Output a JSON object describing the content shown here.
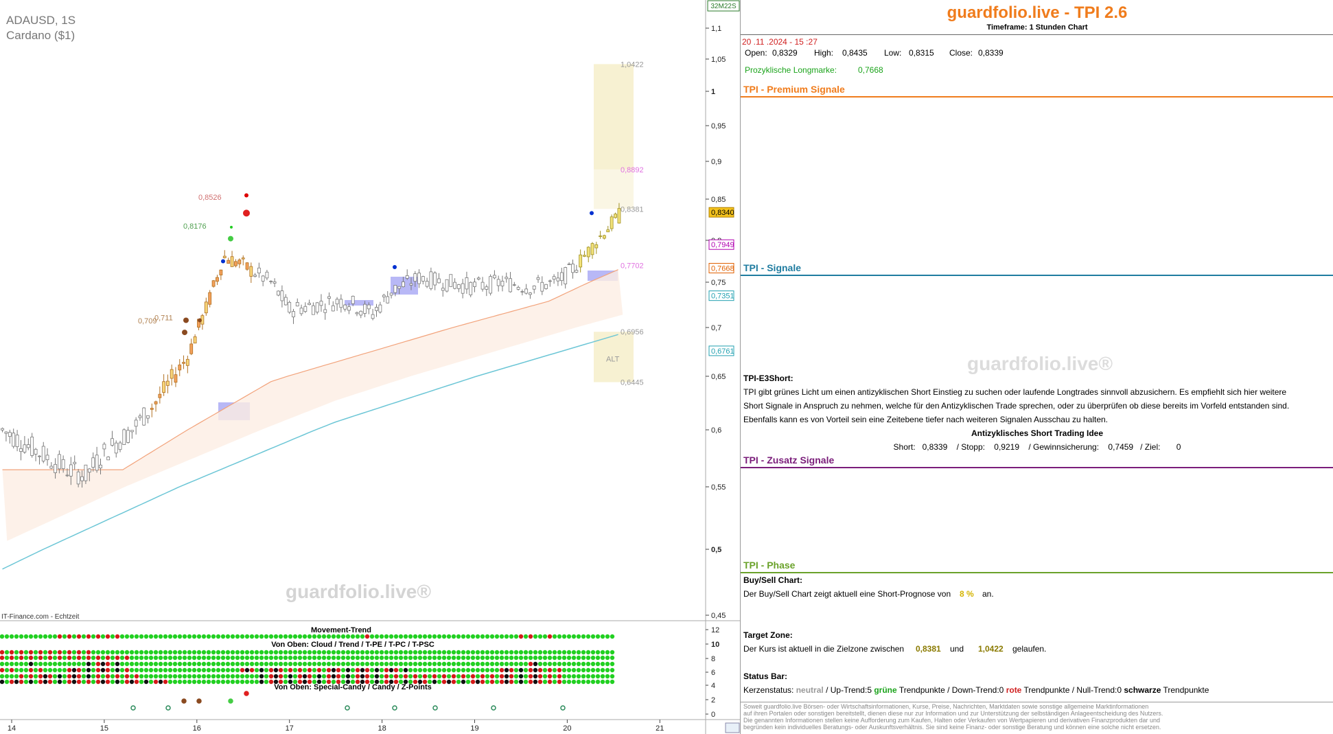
{
  "chart_header": {
    "symbol": "ADAUSD, 1S",
    "name": "Cardano ($1)",
    "timer_badge": "32M22S",
    "source": "IT-Finance.com - Echtzeit",
    "watermark": "guardfolio.live®"
  },
  "chart_data": {
    "type": "candlestick",
    "x_ticks": [
      "14",
      "15",
      "16",
      "17",
      "18",
      "19",
      "20",
      "21"
    ],
    "y_ticks": [
      "1,1",
      "1,05",
      "1",
      "0,95",
      "0,9",
      "0,85",
      "0,8",
      "0,75",
      "0,7",
      "0,65",
      "0,6",
      "0,55",
      "0,5",
      "0,45"
    ],
    "ylim": [
      0.45,
      1.13
    ],
    "price_tags": [
      {
        "label": "0,8340",
        "value": 0.834,
        "bg": "#f4c21d",
        "fg": "#000"
      },
      {
        "label": "0,7949",
        "value": 0.7949,
        "bg": "#fff",
        "fg": "#b000b0"
      },
      {
        "label": "0,7668",
        "value": 0.7668,
        "bg": "#fff",
        "fg": "#e06000"
      },
      {
        "label": "0,7351",
        "value": 0.7351,
        "bg": "#fff",
        "fg": "#20a0b0"
      },
      {
        "label": "0,6761",
        "value": 0.6761,
        "bg": "#fff",
        "fg": "#20a0b0"
      }
    ],
    "level_labels": [
      {
        "label": "1,0422",
        "value": 1.0422,
        "color": "#999"
      },
      {
        "label": "0,8892",
        "value": 0.8892,
        "color": "#e070e0"
      },
      {
        "label": "0,8381",
        "value": 0.8381,
        "color": "#999"
      },
      {
        "label": "0,7702",
        "value": 0.7702,
        "color": "#e070e0"
      },
      {
        "label": "0,6956",
        "value": 0.6956,
        "color": "#999"
      },
      {
        "label": "0,6445",
        "value": 0.6445,
        "color": "#999"
      }
    ],
    "annotations": [
      {
        "label": "0,8526",
        "value": 0.8526,
        "color": "#d07070"
      },
      {
        "label": "0,8176",
        "value": 0.8176,
        "color": "#50a050"
      },
      {
        "label": "0,711",
        "value": 0.711,
        "color": "#b08050"
      },
      {
        "label": "0,709",
        "value": 0.709,
        "color": "#b08050"
      },
      {
        "label": "ALT",
        "value": 0.668,
        "color": "#999"
      }
    ],
    "series": [
      {
        "name": "",
        "x": [
          13.9,
          14.3,
          14.6,
          14.8,
          15.0,
          15.3,
          15.6,
          15.9,
          16.1,
          16.3,
          16.5,
          16.8,
          17.0,
          17.3,
          17.6,
          17.9,
          18.1,
          18.4,
          18.7,
          19.0,
          19.3,
          19.6,
          19.9,
          20.1,
          20.4,
          20.6
        ],
        "values": [
          0.6,
          0.58,
          0.565,
          0.56,
          0.58,
          0.6,
          0.63,
          0.67,
          0.72,
          0.78,
          0.77,
          0.75,
          0.72,
          0.725,
          0.73,
          0.715,
          0.74,
          0.755,
          0.75,
          0.745,
          0.75,
          0.745,
          0.75,
          0.77,
          0.81,
          0.834
        ]
      }
    ]
  },
  "indicators": {
    "title_1": "Movement-Trend",
    "title_2": "Von Oben: Cloud / Trend / T-PE / T-PC / T-PSC",
    "title_3": "Von Oben: Special-Candy / Candy / Z-Points",
    "y_ticks": [
      "12",
      "10",
      "8",
      "6",
      "4",
      "2",
      "0"
    ]
  },
  "panel": {
    "title": "guardfolio.live - TPI 2.6",
    "timeframe": "Timeframe: 1 Stunden Chart",
    "datetime": "20 .11 .2024  - 15 :27",
    "open_label": "Open:",
    "open": "0,8329",
    "high_label": "High:",
    "high": "0,8435",
    "low_label": "Low:",
    "low": "0,8315",
    "close_label": "Close:",
    "close": "0,8339",
    "longmark_label": "Prozyklische Longmarke:",
    "longmark": "0,7668",
    "premium_title": "TPI - Premium Signale",
    "signale_title": "TPI - Signale",
    "e3_title": "TPI-E3Short:",
    "e3_text": "TPI gibt grünes Licht um einen antizyklischen Short Einstieg zu suchen oder laufende Longtrades sinnvoll abzusichern. Es empfiehlt sich hier weitere Short Signale in Anspruch zu nehmen, welche für den Antizyklischen Trade sprechen, oder zu überprüfen ob diese bereits im Vorfeld entstanden sind. Ebenfalls kann es von Vorteil sein eine Zeitebene tiefer nach weiteren Signalen Ausschau zu halten.",
    "idea_title": "Antizyklisches Short Trading Idee",
    "idea_line": "Short:   0,8339    / Stopp:    0,9219    / Gewinnsicherung:    0,7459   / Ziel:       0",
    "zusatz_title": "TPI - Zusatz Signale",
    "phase_title": "TPI - Phase",
    "buysell_title": "Buy/Sell Chart:",
    "buysell_pre": "Der Buy/Sell Chart zeigt aktuell eine Short-Prognose von",
    "buysell_val": "8 %",
    "buysell_post": "an.",
    "target_title": "Target Zone:",
    "target_pre": "Der Kurs ist aktuell in die Zielzone zwischen",
    "target_a": "0,8381",
    "target_und": "und",
    "target_b": "1,0422",
    "target_post": "gelaufen.",
    "status_title": "Status Bar:",
    "status_k": "Kerzenstatus:",
    "status_neutral": "neutral",
    "status_up": "/ Up-Trend:5",
    "status_gruene": "grüne",
    "status_tp1": "Trendpunkte  / Down-Trend:0",
    "status_rote": "rote",
    "status_tp2": "Trendpunkte / Null-Trend:0",
    "status_schwarze": "schwarze",
    "status_tp3": "Trendpunkte",
    "watermark": "guardfolio.live®",
    "disclaimer_1": "Soweit guardfolio.live Börsen- oder Wirtschaftsinformationen, Kurse, Preise, Nachrichten, Marktdaten sowie sonstige allgemeine Marktinformationen",
    "disclaimer_2": "auf ihren Portalen oder sonstigen bereitstellt, dienen diese nur zur Information und zur Unterstützung der selbständigen Anlageentscheidung des Nutzers.",
    "disclaimer_3": "Die genannten Informationen stellen keine Aufforderung zum Kaufen, Halten oder Verkaufen von Wertpapieren und derivativen Finanzprodukten dar und",
    "disclaimer_4": "begründen kein individuelles Beratungs- oder Auskunftsverhältnis. Sie sind keine Finanz- oder sonstige Beratung und können eine solche nicht ersetzen."
  },
  "colors": {
    "brand_orange": "#f07c1c",
    "premium_line": "#f07c1c",
    "signale": "#1f7ca0",
    "zusatz": "#7a1d7a",
    "phase": "#6aa22a",
    "green_text": "#1aa31a",
    "red_text": "#d02020"
  }
}
